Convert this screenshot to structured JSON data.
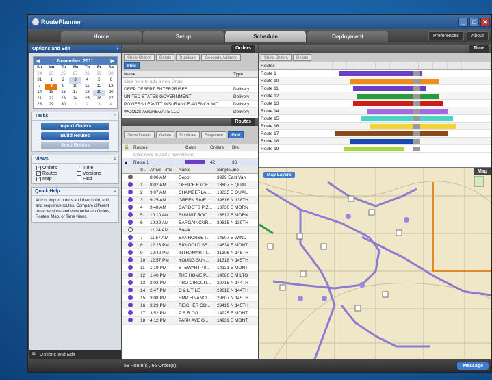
{
  "app": {
    "title": "RoutePlanner"
  },
  "tabs": [
    {
      "label": "Home"
    },
    {
      "label": "Setup"
    },
    {
      "label": "Schedule"
    },
    {
      "label": "Deployment"
    }
  ],
  "topright": {
    "preferences": "Preferences",
    "about": "About"
  },
  "left": {
    "header": "Options and Edit",
    "calendar": {
      "month": "November, 2011",
      "days": [
        "Su",
        "Mo",
        "Tu",
        "We",
        "Th",
        "Fr",
        "Sa"
      ],
      "rows": [
        [
          "24",
          "25",
          "26",
          "27",
          "28",
          "29",
          "30"
        ],
        [
          "31",
          "1",
          "2",
          "3",
          "4",
          "5",
          "6"
        ],
        [
          "7",
          "8",
          "9",
          "10",
          "11",
          "12",
          "13"
        ],
        [
          "14",
          "15",
          "16",
          "17",
          "18",
          "19",
          "20"
        ],
        [
          "21",
          "22",
          "23",
          "24",
          "25",
          "26",
          "27"
        ],
        [
          "28",
          "29",
          "30",
          "1",
          "2",
          "3",
          "4"
        ]
      ]
    },
    "tasks": {
      "title": "Tasks",
      "import": "Import Orders",
      "build": "Build Routes",
      "send": "Send Routes"
    },
    "views": {
      "title": "Views",
      "orders": "Orders",
      "routes": "Routes",
      "map": "Map",
      "time": "Time",
      "versions": "Versions",
      "find": "Find"
    },
    "help": {
      "title": "Quick Help",
      "text": "Add or import orders and then build, edit, and sequence routes. Compare different route versions and view orders in Orders, Routes, Map, or Time views."
    },
    "footer": "Options and Edit"
  },
  "orders": {
    "panel": "Orders",
    "toolbar": [
      "Show Orders",
      "Delete",
      "Duplicate",
      "Geocode Address",
      "Find"
    ],
    "columns": [
      "Name",
      "Type"
    ],
    "hint": "Click here to add a new Order",
    "rows": [
      {
        "name": "DEEP DESERT ENTERPRISES",
        "type": "Delivery"
      },
      {
        "name": "UNITED STATES GOVERNMENT",
        "type": "Delivery"
      },
      {
        "name": "POWERS LEAVITT INSURANCE AGENCY INC",
        "type": "Delivery"
      },
      {
        "name": "WOODS AGGREGATE LLC",
        "type": "Delivery"
      }
    ]
  },
  "routes": {
    "panel": "Routes",
    "toolbar": [
      "Show Details",
      "Delete",
      "Duplicate",
      "Sequence",
      "Find"
    ],
    "columns": [
      "Routes",
      "Color",
      "Orders",
      "Bre"
    ],
    "hint": "Click here to add a new Route",
    "route1": {
      "name": "Route 1",
      "orders": "42",
      "bre": "36"
    },
    "stopcols": [
      "S..",
      "Arrive Time",
      "Name",
      "SimpleLine"
    ],
    "stops": [
      {
        "seq": "",
        "time": "8:00 AM",
        "name": "Depot",
        "addr": "3999 East Van"
      },
      {
        "seq": "1",
        "time": "8:02 AM",
        "name": "OFFICE EXCE...",
        "addr": "13807 E QUAIL"
      },
      {
        "seq": "2",
        "time": "9:07 AM",
        "name": "CHAMBERLAI...",
        "addr": "13835 E QUAIL"
      },
      {
        "seq": "3",
        "time": "9:25 AM",
        "name": "GREEN RIVE...",
        "addr": "39616 N 138TH"
      },
      {
        "seq": "4",
        "time": "9:48 AM",
        "name": "CARDOTS PIZ...",
        "addr": "13730 E MORN"
      },
      {
        "seq": "5",
        "time": "10:10 AM",
        "name": "SUMMIT ROO...",
        "addr": "13612 E MORN"
      },
      {
        "seq": "6",
        "time": "10:39 AM",
        "name": "BARGAINCUR...",
        "addr": "39615 N 139TH"
      },
      {
        "seq": "",
        "time": "11:24 AM",
        "name": "Break",
        "addr": ""
      },
      {
        "seq": "7",
        "time": "11:57 AM",
        "name": "SANHORSE I...",
        "addr": "14507 E WIND"
      },
      {
        "seq": "8",
        "time": "12:23 PM",
        "name": "RIO GOLD SE...",
        "addr": "14634 E MONT"
      },
      {
        "seq": "9",
        "time": "12:42 PM",
        "name": "INTRAMART I...",
        "addr": "31306 N 145TH"
      },
      {
        "seq": "10",
        "time": "12:57 PM",
        "name": "YOUNG SUN...",
        "addr": "31318 N 145TH"
      },
      {
        "seq": "11",
        "time": "1:19 PM",
        "name": "STEWART 48...",
        "addr": "14131 E MONT"
      },
      {
        "seq": "12",
        "time": "1:40 PM",
        "name": "THE HOME P...",
        "addr": "14086 E MILTO"
      },
      {
        "seq": "13",
        "time": "2:02 PM",
        "name": "PRO CIRCUIT...",
        "addr": "29715 N 144TH"
      },
      {
        "seq": "14",
        "time": "2:47 PM",
        "name": "C & L TILE",
        "addr": "29618 N 144TH"
      },
      {
        "seq": "15",
        "time": "3:08 PM",
        "name": "EMP FINANCI...",
        "addr": "29607 N 145TH"
      },
      {
        "seq": "16",
        "time": "3:29 PM",
        "name": "REICHER CO...",
        "addr": "29419 N 145TH"
      },
      {
        "seq": "17",
        "time": "3:52 PM",
        "name": "P S R CO",
        "addr": "14925 E MONT"
      },
      {
        "seq": "18",
        "time": "4:12 PM",
        "name": "PARK AVE G...",
        "addr": "14939 E MONT"
      }
    ]
  },
  "time": {
    "panel": "Time",
    "toolbar": [
      "Show Orders",
      "Delete"
    ],
    "header": "Routes",
    "routes": [
      {
        "name": "Route 1",
        "color": "#6a3fc8"
      },
      {
        "name": "Route 10",
        "color": "#ef8c1a"
      },
      {
        "name": "Route 11",
        "color": "#6a3fc8"
      },
      {
        "name": "Route 12",
        "color": "#2a9a3a"
      },
      {
        "name": "Route 13",
        "color": "#cc1a1a"
      },
      {
        "name": "Route 14",
        "color": "#a36be0"
      },
      {
        "name": "Route 15",
        "color": "#4ad6c6"
      },
      {
        "name": "Route 16",
        "color": "#f2d43a"
      },
      {
        "name": "Route 17",
        "color": "#8b4a1c"
      },
      {
        "name": "Route 18",
        "color": "#1a4ab0"
      },
      {
        "name": "Route 19",
        "color": "#a8d83a"
      }
    ]
  },
  "map": {
    "panel": "Map",
    "layers": "Map Layers"
  },
  "status": {
    "text": "58 Route(s), 66 Order(s).",
    "message": "Message"
  }
}
